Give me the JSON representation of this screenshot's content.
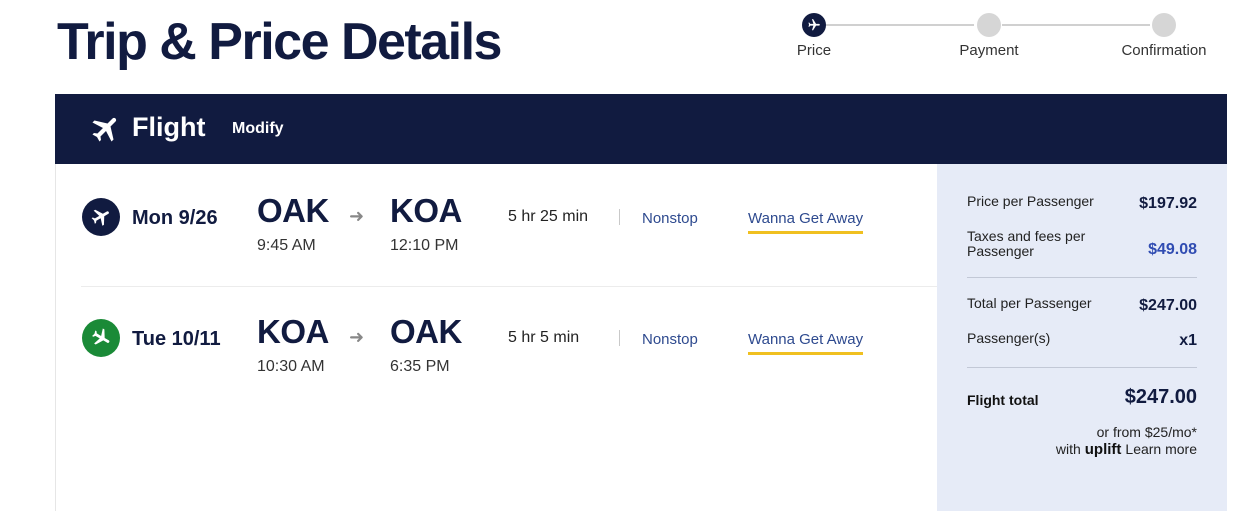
{
  "page": {
    "title": "Trip & Price Details"
  },
  "stepper": {
    "steps": [
      {
        "label": "Price",
        "active": true
      },
      {
        "label": "Payment",
        "active": false
      },
      {
        "label": "Confirmation",
        "active": false
      }
    ]
  },
  "flight_header": {
    "title": "Flight",
    "modify_label": "Modify",
    "icon": "airplane-icon"
  },
  "flights": [
    {
      "date": "Mon 9/26",
      "origin": "OAK",
      "depart_time": "9:45 AM",
      "destination": "KOA",
      "arrive_time": "12:10 PM",
      "duration": "5 hr 25 min",
      "stops": "Nonstop",
      "fare": "Wanna Get Away",
      "icon": "departing-plane-icon",
      "badge_color": "#111b40"
    },
    {
      "date": "Tue 10/11",
      "origin": "KOA",
      "depart_time": "10:30 AM",
      "destination": "OAK",
      "arrive_time": "6:35 PM",
      "duration": "5 hr 5 min",
      "stops": "Nonstop",
      "fare": "Wanna Get Away",
      "icon": "returning-plane-icon",
      "badge_color": "#1a8a37"
    }
  ],
  "summary": {
    "price_per_passenger_label": "Price per Passenger",
    "price_per_passenger": "$197.92",
    "taxes_label": "Taxes and fees per Passenger",
    "taxes": "$49.08",
    "total_per_passenger_label": "Total per Passenger",
    "total_per_passenger": "$247.00",
    "passengers_label": "Passenger(s)",
    "passengers": "x1",
    "flight_total_label": "Flight total",
    "flight_total": "$247.00",
    "financing_text": "or from $25/mo*",
    "with_text": "with",
    "uplift_logo": "uplift",
    "learn_more": "Learn more"
  },
  "colors": {
    "navy": "#111b40",
    "green": "#1a8a37",
    "fare_underline": "#f0c020",
    "summary_bg": "#e6ebf7",
    "link_blue": "#2e4a8f"
  }
}
